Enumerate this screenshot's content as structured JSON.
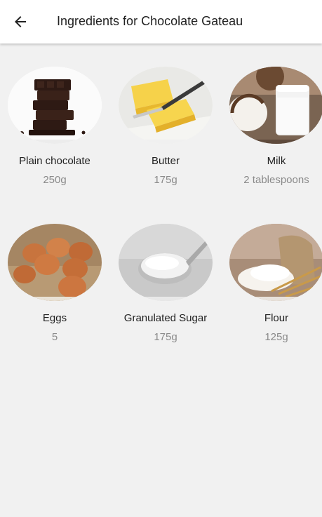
{
  "header": {
    "back_icon": "arrow-left-icon",
    "title": "Ingredients for Chocolate Gateau"
  },
  "ingredients": [
    {
      "name": "Plain chocolate",
      "quantity": "250g",
      "image": "chocolate-image"
    },
    {
      "name": "Butter",
      "quantity": "175g",
      "image": "butter-image"
    },
    {
      "name": "Milk",
      "quantity": "2 tablespoons",
      "image": "milk-image"
    },
    {
      "name": "Eggs",
      "quantity": "5",
      "image": "eggs-image"
    },
    {
      "name": "Granulated Sugar",
      "quantity": "175g",
      "image": "sugar-image"
    },
    {
      "name": "Flour",
      "quantity": "125g",
      "image": "flour-image"
    }
  ],
  "colors": {
    "background": "#f1f1f1",
    "appbar": "#ffffff",
    "title_text": "#212121",
    "quantity_text": "#8a8a8a"
  }
}
